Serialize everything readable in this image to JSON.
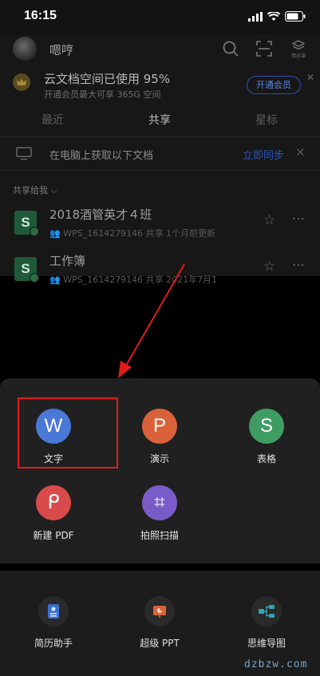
{
  "status": {
    "time": "16:15"
  },
  "header": {
    "username": "嗯哼",
    "badge_text": "精品课"
  },
  "vip": {
    "title": "云文档空间已使用 95%",
    "subtitle": "开通会员最大可享 365G 空间",
    "button": "开通会员"
  },
  "tabs": [
    {
      "label": "最近",
      "active": false
    },
    {
      "label": "共享",
      "active": true
    },
    {
      "label": "星标",
      "active": false
    }
  ],
  "sync": {
    "text": "在电脑上获取以下文档",
    "link": "立即同步"
  },
  "shared_label": "共享给我",
  "files": [
    {
      "name": "2018酒管英才４班",
      "meta": "WPS_1614279146 共享   1个月前更新",
      "icon": "S"
    },
    {
      "name": "工作簿",
      "meta": "WPS_1614279146 共享   2021年7月1",
      "icon": "S"
    }
  ],
  "actions": [
    {
      "label": "文字",
      "glyph": "W",
      "color": "#4a78d6"
    },
    {
      "label": "演示",
      "glyph": "P",
      "color": "#d9623a"
    },
    {
      "label": "表格",
      "glyph": "S",
      "color": "#3f9d63"
    },
    {
      "label": "新建 PDF",
      "glyph": "ᑭ",
      "color": "#d94a4a"
    },
    {
      "label": "拍照扫描",
      "glyph": "⌗",
      "color": "#7a5cc9"
    }
  ],
  "tools": [
    {
      "label": "简历助手",
      "icon": "resume-icon"
    },
    {
      "label": "超级 PPT",
      "icon": "ppt-icon"
    },
    {
      "label": "思维导图",
      "icon": "mindmap-icon"
    }
  ],
  "watermark": "dzbzw.com"
}
